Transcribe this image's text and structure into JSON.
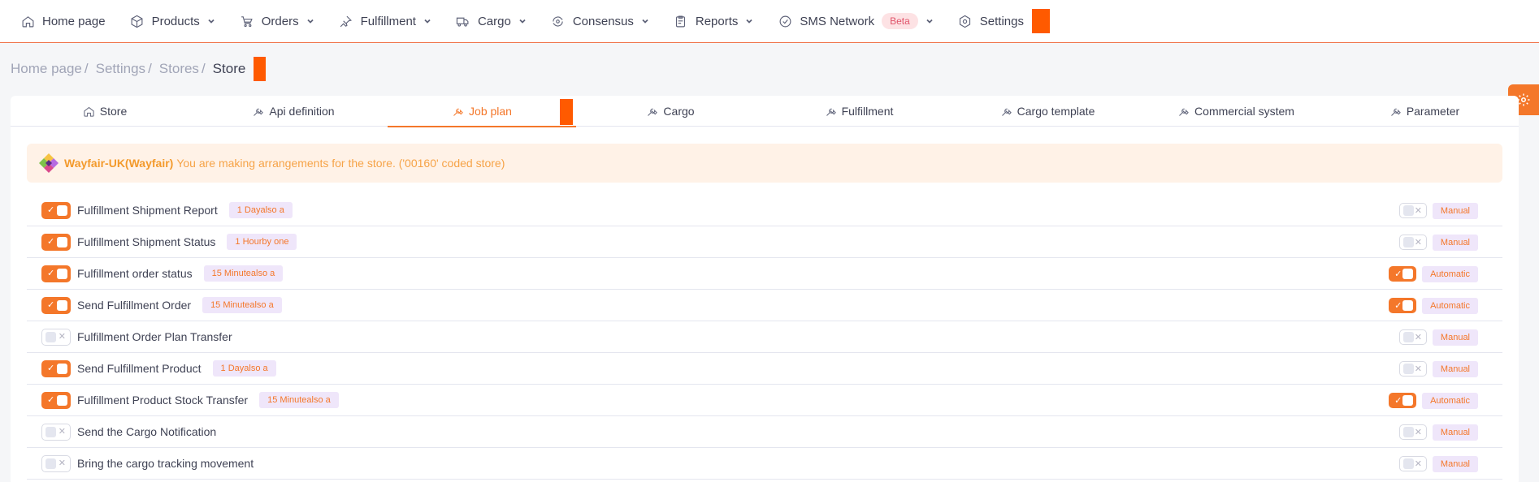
{
  "nav": {
    "items": [
      {
        "label": "Home page",
        "icon": "home-icon",
        "has_dropdown": false
      },
      {
        "label": "Products",
        "icon": "box-icon",
        "has_dropdown": true
      },
      {
        "label": "Orders",
        "icon": "cart-icon",
        "has_dropdown": true
      },
      {
        "label": "Fulfillment",
        "icon": "pin-icon",
        "has_dropdown": true
      },
      {
        "label": "Cargo",
        "icon": "truck-icon",
        "has_dropdown": true
      },
      {
        "label": "Consensus",
        "icon": "sync-icon",
        "has_dropdown": true
      },
      {
        "label": "Reports",
        "icon": "clipboard-icon",
        "has_dropdown": true
      },
      {
        "label": "SMS Network",
        "icon": "check-circle-icon",
        "has_dropdown": true,
        "badge": "Beta"
      },
      {
        "label": "Settings",
        "icon": "gear-icon",
        "has_dropdown": false
      }
    ]
  },
  "breadcrumb": {
    "items": [
      "Home page",
      "Settings",
      "Stores"
    ],
    "separator": "/",
    "current": "Store"
  },
  "tabs": [
    {
      "label": "Store",
      "icon": "home-icon",
      "active": false
    },
    {
      "label": "Api definition",
      "icon": "wrench-icon",
      "active": false
    },
    {
      "label": "Job plan",
      "icon": "wrench-icon",
      "active": true
    },
    {
      "label": "Cargo",
      "icon": "wrench-icon",
      "active": false
    },
    {
      "label": "Fulfillment",
      "icon": "wrench-icon",
      "active": false
    },
    {
      "label": "Cargo template",
      "icon": "wrench-icon",
      "active": false
    },
    {
      "label": "Commercial system",
      "icon": "wrench-icon",
      "active": false
    },
    {
      "label": "Parameter",
      "icon": "wrench-icon",
      "active": false
    }
  ],
  "alert": {
    "store_name": "Wayfair-UK(Wayfair)",
    "message": "You are making arrangements for the store. ('00160' coded store)"
  },
  "jobs": [
    {
      "name": "Fulfillment Shipment Report",
      "enabled": true,
      "frequency": "1 Dayalso a",
      "auto": false,
      "mode": "Manual"
    },
    {
      "name": "Fulfillment Shipment Status",
      "enabled": true,
      "frequency": "1 Hourby one",
      "auto": false,
      "mode": "Manual"
    },
    {
      "name": "Fulfillment order status",
      "enabled": true,
      "frequency": "15 Minutealso a",
      "auto": true,
      "mode": "Automatic"
    },
    {
      "name": "Send Fulfillment Order",
      "enabled": true,
      "frequency": "15 Minutealso a",
      "auto": true,
      "mode": "Automatic"
    },
    {
      "name": "Fulfillment Order Plan Transfer",
      "enabled": false,
      "frequency": "",
      "auto": false,
      "mode": "Manual"
    },
    {
      "name": "Send Fulfillment Product",
      "enabled": true,
      "frequency": "1 Dayalso a",
      "auto": false,
      "mode": "Manual"
    },
    {
      "name": "Fulfillment Product Stock Transfer",
      "enabled": true,
      "frequency": "15 Minutealso a",
      "auto": true,
      "mode": "Automatic"
    },
    {
      "name": "Send the Cargo Notification",
      "enabled": false,
      "frequency": "",
      "auto": false,
      "mode": "Manual"
    },
    {
      "name": "Bring the cargo tracking movement",
      "enabled": false,
      "frequency": "",
      "auto": false,
      "mode": "Manual"
    }
  ],
  "colors": {
    "accent": "#f4772a",
    "redaction": "#ff5a00",
    "alert_bg": "#fff2e7",
    "badge_bg": "#efe6fa"
  }
}
